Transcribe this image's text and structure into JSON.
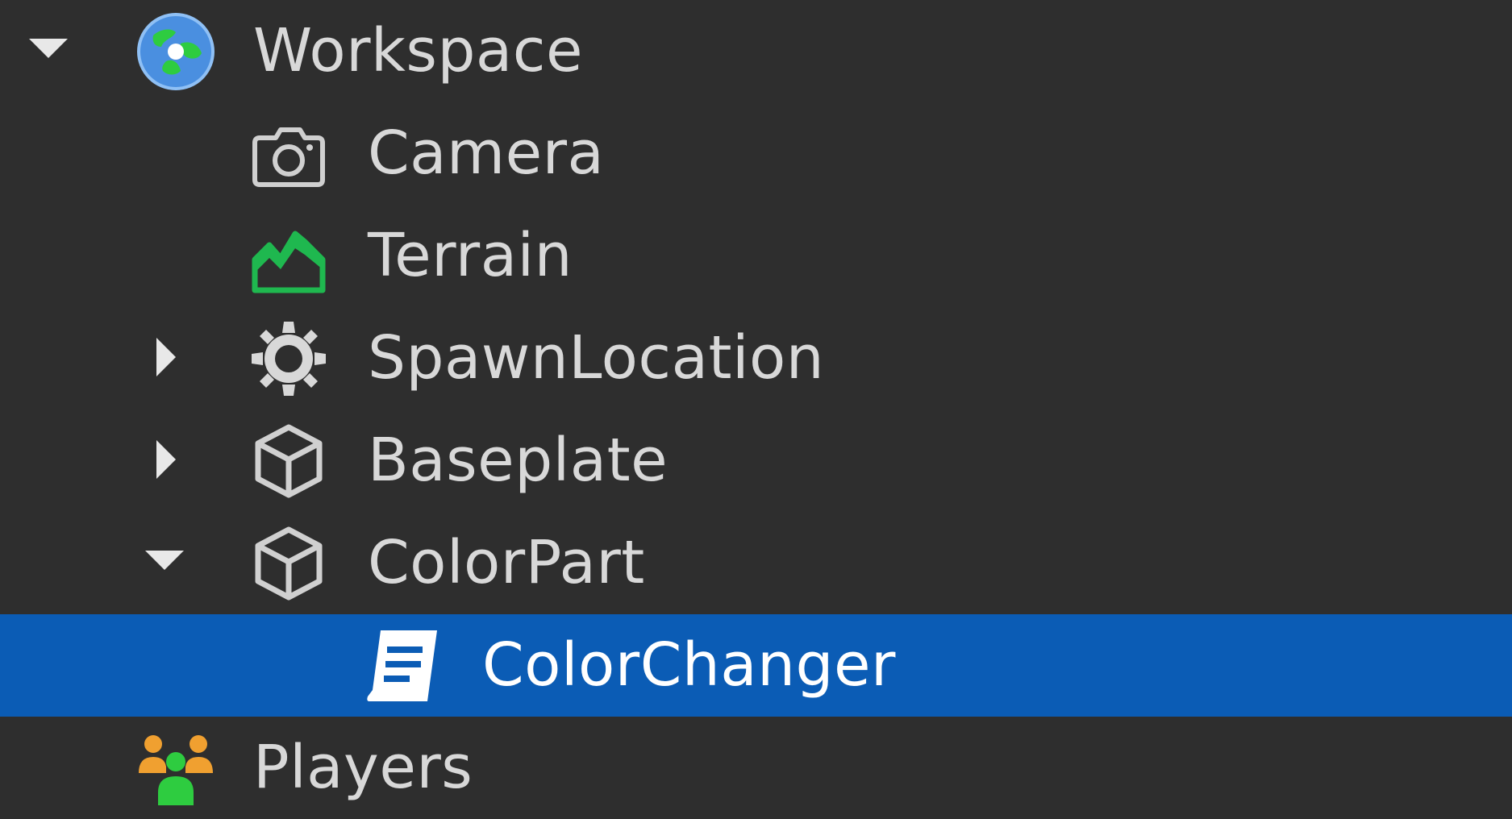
{
  "explorer": {
    "items": [
      {
        "label": "Workspace",
        "icon": "globe-icon",
        "toggle": "expanded"
      },
      {
        "label": "Camera",
        "icon": "camera-icon",
        "toggle": "none"
      },
      {
        "label": "Terrain",
        "icon": "terrain-icon",
        "toggle": "none"
      },
      {
        "label": "SpawnLocation",
        "icon": "spawn-gear-icon",
        "toggle": "collapsed"
      },
      {
        "label": "Baseplate",
        "icon": "part-cube-icon",
        "toggle": "collapsed"
      },
      {
        "label": "ColorPart",
        "icon": "part-cube-icon",
        "toggle": "expanded"
      },
      {
        "label": "ColorChanger",
        "icon": "script-icon",
        "toggle": "none",
        "selected": true
      },
      {
        "label": "Players",
        "icon": "players-icon",
        "toggle": "none"
      }
    ],
    "colors": {
      "background": "#2e2e2e",
      "selection": "#0b5cb5",
      "text": "#d8d8d8",
      "terrain_green": "#1fb84f",
      "players_orange": "#f0a030",
      "players_green": "#2ecc40"
    }
  }
}
